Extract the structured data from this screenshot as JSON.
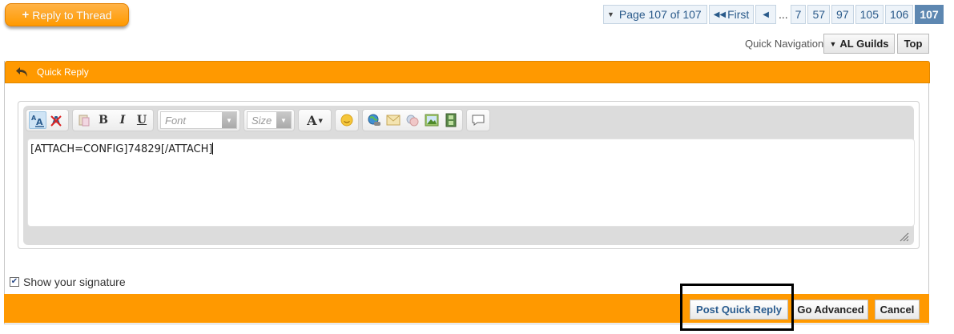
{
  "reply_button": {
    "label": "Reply to Thread",
    "icon": "plus-icon"
  },
  "pagination": {
    "page_label": "Page 107 of 107",
    "first_label": "First",
    "ellipsis": "...",
    "pages": [
      "7",
      "57",
      "97",
      "105",
      "106"
    ],
    "current_page": "107"
  },
  "quick_navigation": {
    "label": "Quick Navigation",
    "guilds_label": "AL Guilds",
    "top_label": "Top"
  },
  "quick_reply": {
    "title": "Quick Reply",
    "toolbar": {
      "font_placeholder": "Font",
      "size_placeholder": "Size",
      "bold": "B",
      "italic": "I",
      "underline": "U",
      "text_color": "A"
    },
    "editor_text": "[ATTACH=CONFIG]74829[/ATTACH]",
    "show_signature_label": "Show your signature",
    "show_signature_checked": true,
    "buttons": {
      "post": "Post Quick Reply",
      "advanced": "Go Advanced",
      "cancel": "Cancel"
    }
  },
  "colors": {
    "accent_orange": "#ff9900",
    "pager_current": "#5d87b1",
    "link_blue": "#2a5c8f"
  }
}
